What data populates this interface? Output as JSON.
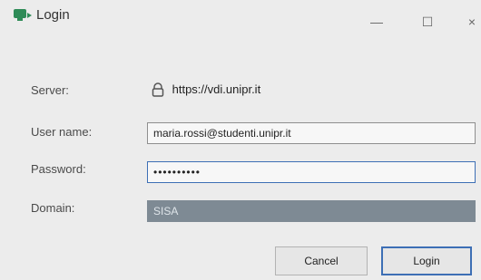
{
  "window": {
    "title": "Login",
    "minimize_glyph": "—",
    "maximize_glyph": "☐",
    "close_glyph": "×"
  },
  "form": {
    "server_label": "Server:",
    "server_value": "https://vdi.unipr.it",
    "username_label": "User name:",
    "username_value": "maria.rossi@studenti.unipr.it",
    "password_label": "Password:",
    "password_value": "••••••••••",
    "domain_label": "Domain:",
    "domain_value": "SISA"
  },
  "buttons": {
    "cancel_label": "Cancel",
    "login_label": "Login"
  },
  "colors": {
    "accent": "#3d6fb5",
    "app_icon": "#2e8b57",
    "domain_field_bg": "#7e8a94"
  },
  "icons": {
    "app": "app-logo-icon",
    "server": "lock-icon"
  }
}
